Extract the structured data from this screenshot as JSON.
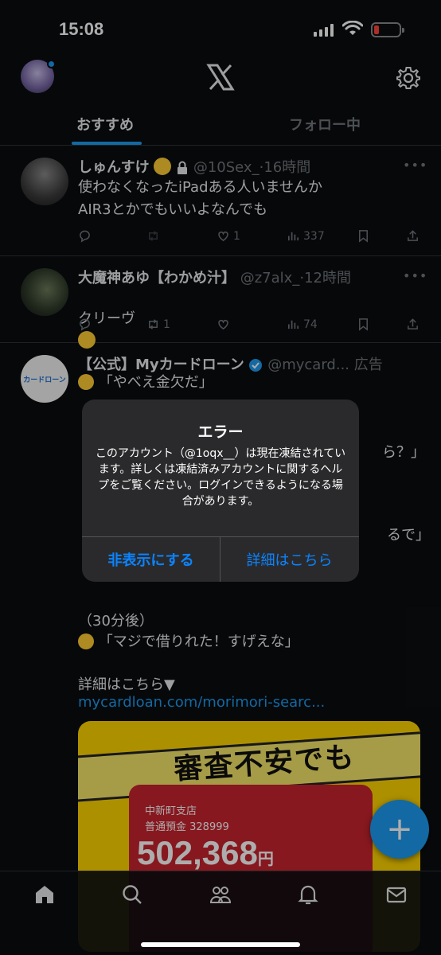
{
  "status": {
    "time": "15:08"
  },
  "header": {
    "tabs": [
      {
        "label": "おすすめ"
      },
      {
        "label": "フォロー中"
      }
    ]
  },
  "tweets": [
    {
      "name": "しゅんすけ",
      "handle": "@10Sex_",
      "time": "16時間",
      "text": "使わなくなったiPadある人いませんか\nAIR3とかでもいいよなんでも",
      "stats": {
        "replies": "",
        "reposts": "",
        "likes": "1",
        "views": "337"
      }
    },
    {
      "name": "大魔神あゆ【わかめ汁】",
      "handle": "@z7alx_",
      "time": "12時間",
      "text": "クリーヴ",
      "stats": {
        "replies": "",
        "reposts": "1",
        "likes": "",
        "views": "74"
      }
    }
  ],
  "ad": {
    "name": "【公式】Myカードローン",
    "handle": "@mycard...",
    "badge": "広告",
    "lines": [
      "「やべえ金欠だ」",
      "ら？」",
      "るで」",
      "（30分後）",
      "「マジで借りれた！すげえな」",
      "詳細はこちら▼"
    ],
    "link": "mycardloan.com/morimori-searc...",
    "image": {
      "headline": "審査不安でも",
      "branch": "中新町支店",
      "account": "普通預金 328999",
      "amount": "502,368",
      "unit": "円"
    },
    "logo_text": "カードローン"
  },
  "alert": {
    "title": "エラー",
    "message": "このアカウント（@1oqx__）は現在凍結されています。詳しくは凍結済みアカウントに関するヘルプをご覧ください。ログインできるようになる場合があります。",
    "dismiss": "非表示にする",
    "details": "詳細はこちら"
  },
  "colors": {
    "accent": "#1d9bf0",
    "alert_button": "#0a84ff",
    "background": "#0b0d10"
  }
}
